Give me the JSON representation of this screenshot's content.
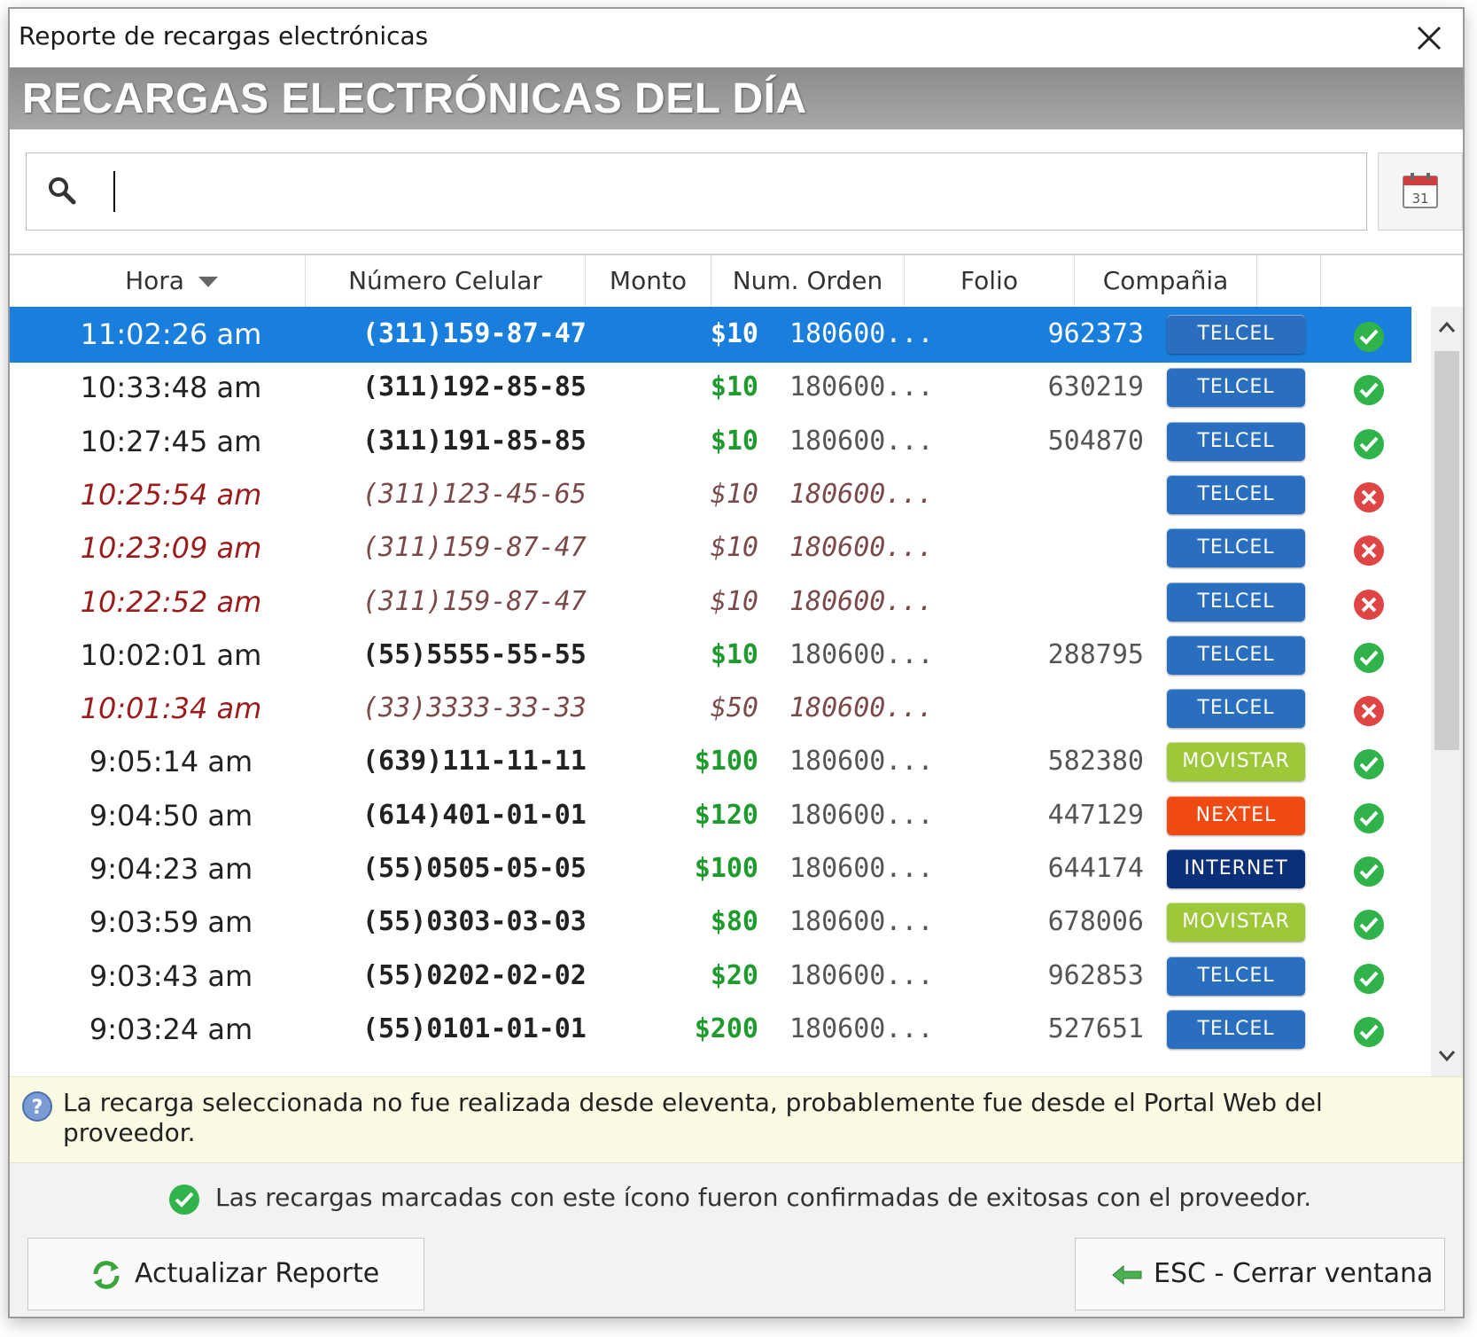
{
  "window": {
    "title": "Reporte de recargas electrónicas"
  },
  "banner": {
    "title": "RECARGAS ELECTRÓNICAS DEL DÍA"
  },
  "search": {
    "value": "",
    "placeholder": ""
  },
  "calendar": {
    "icon": "calendar-icon",
    "day": "31"
  },
  "table": {
    "headers": [
      "Hora",
      "Número Celular",
      "Monto",
      "Num. Orden",
      "Folio",
      "Compañia"
    ],
    "rows": [
      {
        "hora": "11:02:26 am",
        "numero": "(311)159-87-47",
        "monto": "$10",
        "orden": "180600...",
        "folio": "962373",
        "compania": "TELCEL",
        "status": "ok",
        "selected": true
      },
      {
        "hora": "10:33:48 am",
        "numero": "(311)192-85-85",
        "monto": "$10",
        "orden": "180600...",
        "folio": "630219",
        "compania": "TELCEL",
        "status": "ok"
      },
      {
        "hora": "10:27:45 am",
        "numero": "(311)191-85-85",
        "monto": "$10",
        "orden": "180600...",
        "folio": "504870",
        "compania": "TELCEL",
        "status": "ok"
      },
      {
        "hora": "10:25:54 am",
        "numero": "(311)123-45-65",
        "monto": "$10",
        "orden": "180600...",
        "folio": "",
        "compania": "TELCEL",
        "status": "fail"
      },
      {
        "hora": "10:23:09 am",
        "numero": "(311)159-87-47",
        "monto": "$10",
        "orden": "180600...",
        "folio": "",
        "compania": "TELCEL",
        "status": "fail"
      },
      {
        "hora": "10:22:52 am",
        "numero": "(311)159-87-47",
        "monto": "$10",
        "orden": "180600...",
        "folio": "",
        "compania": "TELCEL",
        "status": "fail"
      },
      {
        "hora": "10:02:01 am",
        "numero": "(55)5555-55-55",
        "monto": "$10",
        "orden": "180600...",
        "folio": "288795",
        "compania": "TELCEL",
        "status": "ok"
      },
      {
        "hora": "10:01:34 am",
        "numero": "(33)3333-33-33",
        "monto": "$50",
        "orden": "180600...",
        "folio": "",
        "compania": "TELCEL",
        "status": "fail"
      },
      {
        "hora": "9:05:14 am",
        "numero": "(639)111-11-11",
        "monto": "$100",
        "orden": "180600...",
        "folio": "582380",
        "compania": "MOVISTAR",
        "status": "ok"
      },
      {
        "hora": "9:04:50 am",
        "numero": "(614)401-01-01",
        "monto": "$120",
        "orden": "180600...",
        "folio": "447129",
        "compania": "NEXTEL",
        "status": "ok"
      },
      {
        "hora": "9:04:23 am",
        "numero": "(55)0505-05-05",
        "monto": "$100",
        "orden": "180600...",
        "folio": "644174",
        "compania": "INTERNET",
        "status": "ok"
      },
      {
        "hora": "9:03:59 am",
        "numero": "(55)0303-03-03",
        "monto": "$80",
        "orden": "180600...",
        "folio": "678006",
        "compania": "MOVISTAR",
        "status": "ok"
      },
      {
        "hora": "9:03:43 am",
        "numero": "(55)0202-02-02",
        "monto": "$20",
        "orden": "180600...",
        "folio": "962853",
        "compania": "TELCEL",
        "status": "ok"
      },
      {
        "hora": "9:03:24 am",
        "numero": "(55)0101-01-01",
        "monto": "$200",
        "orden": "180600...",
        "folio": "527651",
        "compania": "TELCEL",
        "status": "ok"
      }
    ]
  },
  "company_colors": {
    "TELCEL": "#2a6fbf",
    "MOVISTAR": "#9cc83a",
    "NEXTEL": "#ee4a12",
    "INTERNET": "#0c2f7a"
  },
  "colors": {
    "selected": "#1a7fdc",
    "ok": "#2fb34a",
    "fail": "#e04545",
    "amount": "#1f9a2e"
  },
  "info": {
    "text": "La recarga seleccionada no fue realizada desde eleventa, probablemente fue desde el Portal Web del proveedor."
  },
  "legend": {
    "text": "Las recargas marcadas con este ícono fueron confirmadas de exitosas con el proveedor."
  },
  "buttons": {
    "refresh": "Actualizar Reporte",
    "close": "ESC - Cerrar ventana"
  }
}
